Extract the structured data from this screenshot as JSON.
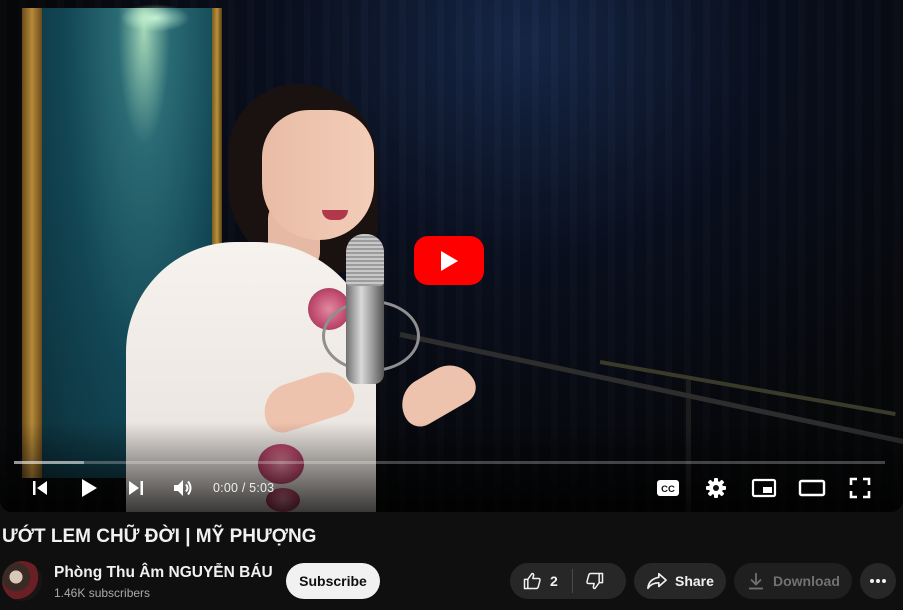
{
  "player": {
    "current_time": "0:00",
    "time_separator": " / ",
    "duration": "5:03",
    "progress_played_fraction": 0.0,
    "progress_loaded_fraction": 0.08,
    "cc_label": "CC"
  },
  "video": {
    "title": "ƯỚT LEM CHỮ ĐỜI | MỸ PHƯỢNG"
  },
  "channel": {
    "name": "Phòng Thu Âm NGUYỄN BÁU",
    "subscribers": "1.46K subscribers",
    "subscribe_label": "Subscribe"
  },
  "actions": {
    "like_count": "2",
    "share_label": "Share",
    "download_label": "Download"
  },
  "colors": {
    "accent": "#ff0000",
    "background": "#0f0f0f",
    "pill": "#272727"
  },
  "icons": [
    "play-icon",
    "previous-icon",
    "next-icon",
    "volume-icon",
    "cc-icon",
    "settings-gear-icon",
    "miniplayer-icon",
    "theater-mode-icon",
    "fullscreen-icon",
    "like-thumb-icon",
    "dislike-thumb-icon",
    "share-arrow-icon",
    "download-icon",
    "more-dots-icon"
  ]
}
